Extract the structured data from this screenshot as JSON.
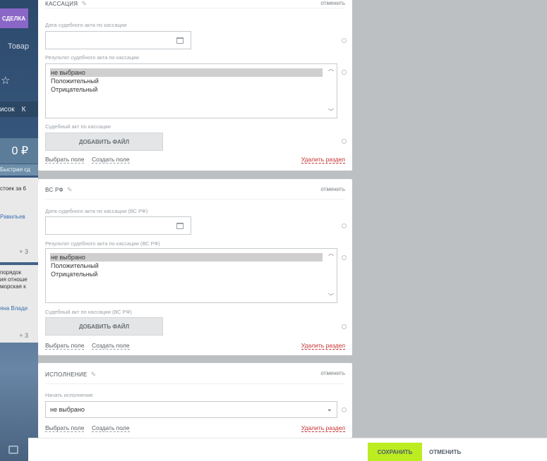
{
  "background": {
    "deal_button": "СДЕЛКА",
    "goods_tab": "Товар",
    "tabs_row": [
      "исок",
      "К"
    ],
    "price": "0 ₽",
    "quick": "Быстрая сд",
    "text1": "стоек за 6",
    "user1": "Равильев",
    "plus1": "+ 3",
    "text2": [
      "порядок",
      "ия отноше",
      "морская к"
    ],
    "user2": "яна Влади",
    "plus2": "+ 3"
  },
  "sections": {
    "cassation": {
      "title": "КАССАЦИЯ",
      "cancel": "отменить",
      "date_label": "Дата судебного акта по кассации",
      "result_label": "Результат судебного акта по кассации",
      "options": [
        "не выбрано",
        "Положительный",
        "Отрицательный"
      ],
      "file_label": "Судебный акт по кассации",
      "add_file": "ДОБАВИТЬ ФАЙЛ",
      "choose_field": "Выбрать поле",
      "create_field": "Создать поле",
      "delete_section": "Удалить раздел"
    },
    "vsrf": {
      "title": "ВС РФ",
      "cancel": "отменить",
      "date_label": "Дата судебного акта по кассации (ВС РФ)",
      "result_label": "Результат судебного акта по кассации (ВС РФ)",
      "options": [
        "не выбрано",
        "Положительный",
        "Отрицательный"
      ],
      "file_label": "Судебный акт по кассации (ВС РФ)",
      "add_file": "ДОБАВИТЬ ФАЙЛ",
      "choose_field": "Выбрать поле",
      "create_field": "Создать поле",
      "delete_section": "Удалить раздел"
    },
    "execution": {
      "title": "ИСПОЛНЕНИЕ",
      "cancel": "отменить",
      "start_label": "Начать исполнение",
      "select_value": "не выбрано",
      "choose_field": "Выбрать поле",
      "create_field": "Создать поле",
      "delete_section": "Удалить раздел"
    }
  },
  "footer": {
    "save": "СОХРАНИТЬ",
    "cancel": "ОТМЕНИТЬ"
  },
  "colors": {
    "save_button": "#bbed21",
    "delete_link": "#c62c2c",
    "deal_button": "#8a66c7"
  }
}
